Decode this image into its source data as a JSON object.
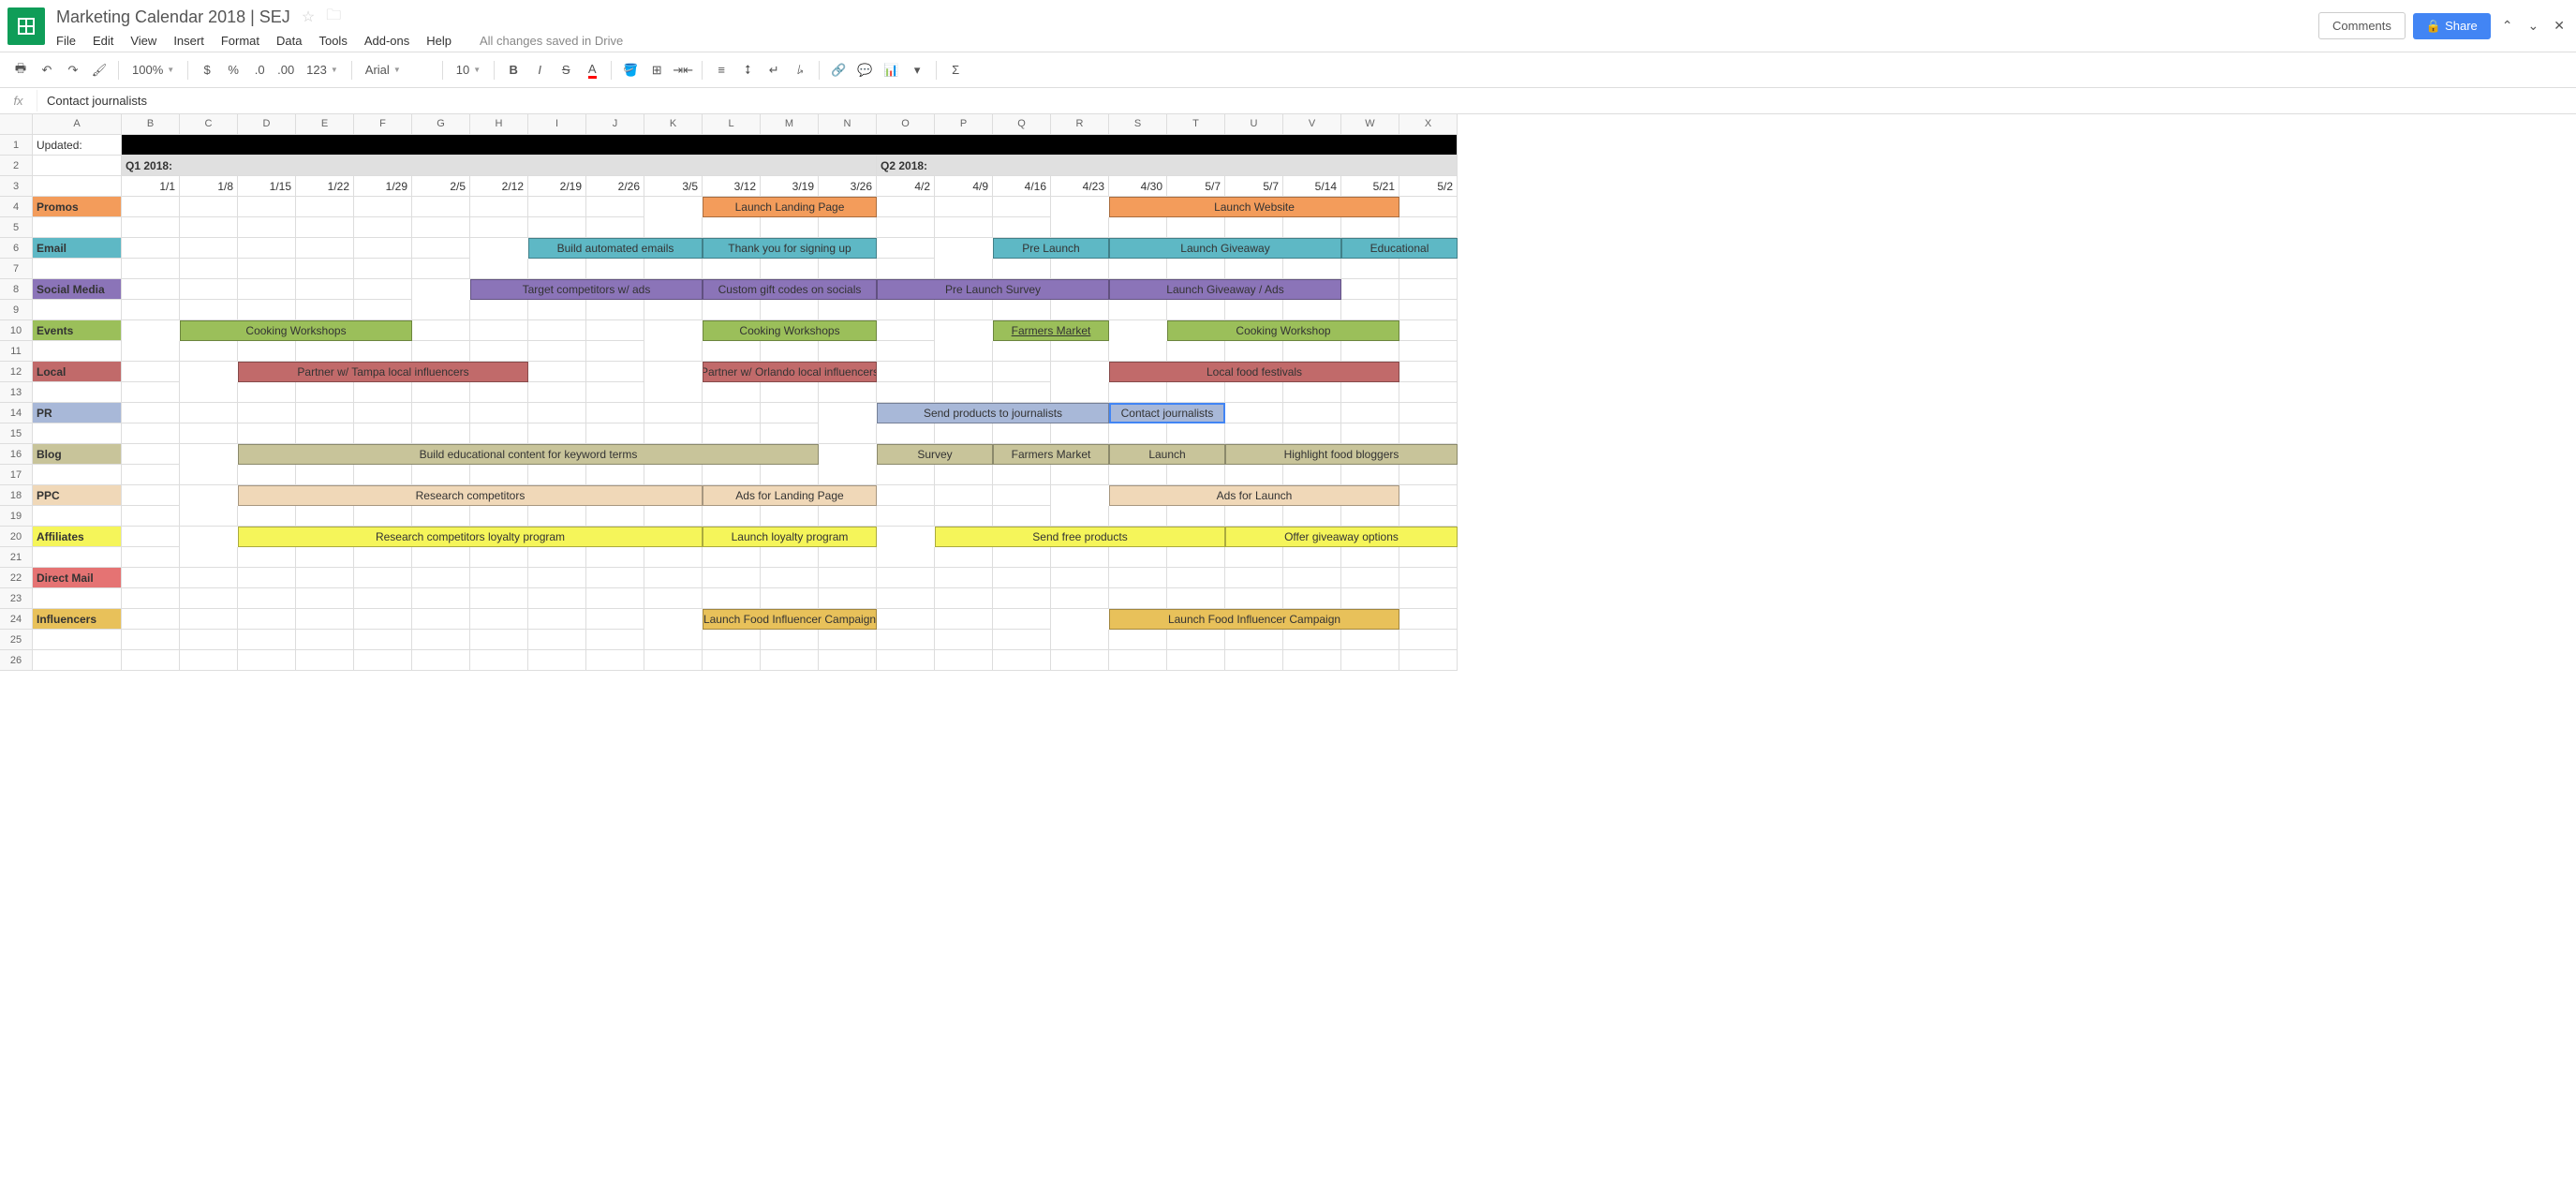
{
  "header": {
    "doc_title": "Marketing Calendar 2018 | SEJ",
    "menu": [
      "File",
      "Edit",
      "View",
      "Insert",
      "Format",
      "Data",
      "Tools",
      "Add-ons",
      "Help"
    ],
    "save_status": "All changes saved in Drive",
    "comments_btn": "Comments",
    "share_btn": "Share"
  },
  "toolbar": {
    "zoom": "100%",
    "font": "Arial",
    "font_size": "10",
    "number_format": "123"
  },
  "formula_bar": {
    "fx": "fx",
    "value": "Contact journalists"
  },
  "columns": [
    "A",
    "B",
    "C",
    "D",
    "E",
    "F",
    "G",
    "H",
    "I",
    "J",
    "K",
    "L",
    "M",
    "N",
    "O",
    "P",
    "Q",
    "R",
    "S",
    "T",
    "U",
    "V",
    "W",
    "X"
  ],
  "row_count": 26,
  "cells": {
    "A1": "Updated:",
    "B2": "Q1 2018:",
    "O2": "Q2 2018:",
    "dates": [
      "1/1",
      "1/8",
      "1/15",
      "1/22",
      "1/29",
      "2/5",
      "2/12",
      "2/19",
      "2/26",
      "3/5",
      "3/12",
      "3/19",
      "3/26",
      "4/2",
      "4/9",
      "4/16",
      "4/23",
      "4/30",
      "5/7",
      "5/7",
      "5/14",
      "5/21",
      "5/2"
    ],
    "categories": {
      "4": "Promos",
      "6": "Email",
      "8": "Social Media",
      "10": "Events",
      "12": "Local",
      "14": "PR",
      "16": "Blog",
      "18": "PPC",
      "20": "Affiliates",
      "22": "Direct Mail",
      "24": "Influencers"
    }
  },
  "tasks": [
    {
      "row": 4,
      "start": 12,
      "span": 3,
      "cls": "t-promos",
      "text": "Launch Landing Page"
    },
    {
      "row": 4,
      "start": 19,
      "span": 5,
      "cls": "t-promos",
      "text": "Launch Website"
    },
    {
      "row": 6,
      "start": 9,
      "span": 3,
      "cls": "t-email",
      "text": "Build automated emails"
    },
    {
      "row": 6,
      "start": 12,
      "span": 3,
      "cls": "t-email",
      "text": "Thank you for signing up"
    },
    {
      "row": 6,
      "start": 17,
      "span": 2,
      "cls": "t-email",
      "text": "Pre Launch"
    },
    {
      "row": 6,
      "start": 19,
      "span": 4,
      "cls": "t-email",
      "text": "Launch Giveaway"
    },
    {
      "row": 6,
      "start": 23,
      "span": 2,
      "cls": "t-email",
      "text": "Educational"
    },
    {
      "row": 8,
      "start": 8,
      "span": 4,
      "cls": "t-social",
      "text": "Target competitors w/ ads"
    },
    {
      "row": 8,
      "start": 12,
      "span": 3,
      "cls": "t-social",
      "text": "Custom gift codes on socials"
    },
    {
      "row": 8,
      "start": 15,
      "span": 4,
      "cls": "t-social",
      "text": "Pre Launch Survey"
    },
    {
      "row": 8,
      "start": 19,
      "span": 4,
      "cls": "t-social",
      "text": "Launch Giveaway / Ads"
    },
    {
      "row": 10,
      "start": 3,
      "span": 4,
      "cls": "t-events",
      "text": "Cooking Workshops"
    },
    {
      "row": 10,
      "start": 12,
      "span": 3,
      "cls": "t-events",
      "text": "Cooking Workshops"
    },
    {
      "row": 10,
      "start": 17,
      "span": 2,
      "cls": "t-events",
      "text": "Farmers Market",
      "underline": true
    },
    {
      "row": 10,
      "start": 20,
      "span": 4,
      "cls": "t-events",
      "text": "Cooking Workshop"
    },
    {
      "row": 12,
      "start": 4,
      "span": 5,
      "cls": "t-local",
      "text": "Partner w/ Tampa local influencers"
    },
    {
      "row": 12,
      "start": 12,
      "span": 3,
      "cls": "t-local",
      "text": "Partner w/ Orlando local influencers"
    },
    {
      "row": 12,
      "start": 19,
      "span": 5,
      "cls": "t-local",
      "text": "Local food festivals"
    },
    {
      "row": 14,
      "start": 15,
      "span": 4,
      "cls": "t-pr",
      "text": "Send products to journalists"
    },
    {
      "row": 14,
      "start": 19,
      "span": 2,
      "cls": "t-pr",
      "text": "Contact journalists",
      "selected": true
    },
    {
      "row": 16,
      "start": 4,
      "span": 10,
      "cls": "t-blog",
      "text": "Build educational content for keyword terms"
    },
    {
      "row": 16,
      "start": 15,
      "span": 2,
      "cls": "t-blog",
      "text": "Survey"
    },
    {
      "row": 16,
      "start": 17,
      "span": 2,
      "cls": "t-blog",
      "text": "Farmers Market"
    },
    {
      "row": 16,
      "start": 19,
      "span": 2,
      "cls": "t-blog",
      "text": "Launch"
    },
    {
      "row": 16,
      "start": 21,
      "span": 4,
      "cls": "t-blog",
      "text": "Highlight food bloggers"
    },
    {
      "row": 18,
      "start": 4,
      "span": 8,
      "cls": "t-ppc",
      "text": "Research competitors"
    },
    {
      "row": 18,
      "start": 12,
      "span": 3,
      "cls": "t-ppc",
      "text": "Ads for Landing Page"
    },
    {
      "row": 18,
      "start": 19,
      "span": 5,
      "cls": "t-ppc",
      "text": "Ads for Launch"
    },
    {
      "row": 20,
      "start": 4,
      "span": 8,
      "cls": "t-affiliates",
      "text": "Research competitors loyalty program"
    },
    {
      "row": 20,
      "start": 12,
      "span": 3,
      "cls": "t-affiliates",
      "text": "Launch loyalty program"
    },
    {
      "row": 20,
      "start": 16,
      "span": 5,
      "cls": "t-affiliates",
      "text": "Send free products"
    },
    {
      "row": 20,
      "start": 21,
      "span": 4,
      "cls": "t-affiliates",
      "text": "Offer giveaway options"
    },
    {
      "row": 24,
      "start": 12,
      "span": 3,
      "cls": "t-influencers",
      "text": "Launch Food Influencer Campaign"
    },
    {
      "row": 24,
      "start": 19,
      "span": 5,
      "cls": "t-influencers",
      "text": "Launch Food Influencer Campaign"
    }
  ],
  "category_colors": {
    "4": "cat-promos",
    "6": "cat-email",
    "8": "cat-social",
    "10": "cat-events",
    "12": "cat-local",
    "14": "cat-pr",
    "16": "cat-blog",
    "18": "cat-ppc",
    "20": "cat-affiliates",
    "22": "cat-direct",
    "24": "cat-influencers"
  }
}
